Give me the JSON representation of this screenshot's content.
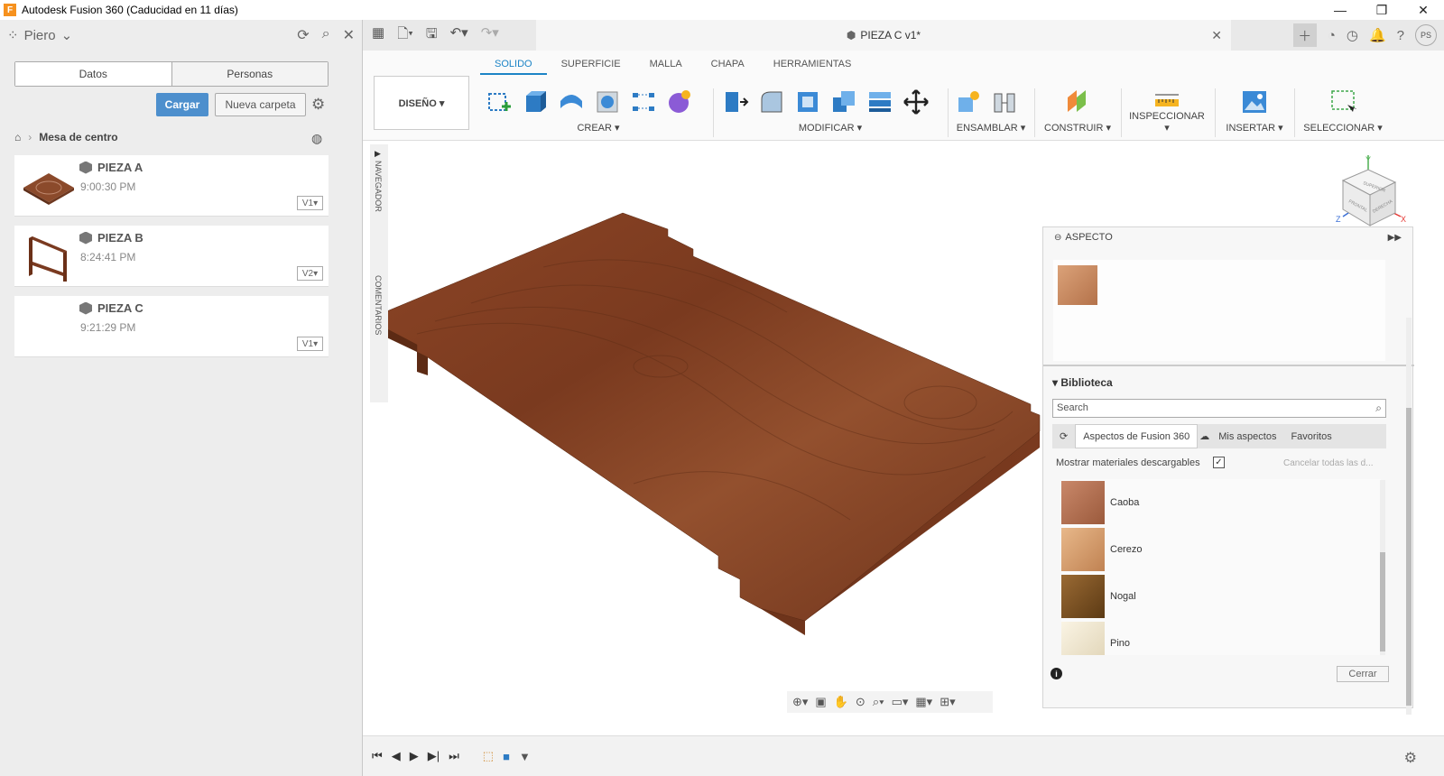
{
  "window": {
    "app_icon": "F",
    "title": "Autodesk Fusion 360 (Caducidad en 11 días)",
    "controls": [
      "—",
      "❐",
      "✕"
    ]
  },
  "data_panel": {
    "team": "Piero",
    "tabs": [
      "Datos",
      "Personas"
    ],
    "upload_label": "Cargar",
    "new_folder_label": "Nueva carpeta",
    "breadcrumb": "Mesa de centro",
    "files": [
      {
        "name": "PIEZA A",
        "time": "9:00:30 PM",
        "version": "V1▾"
      },
      {
        "name": "PIEZA B",
        "time": "8:24:41 PM",
        "version": "V2▾"
      },
      {
        "name": "PIEZA C",
        "time": "9:21:29 PM",
        "version": "V1▾"
      }
    ]
  },
  "document": {
    "tab_title": "PIEZA C v1*",
    "user_initials": "PS"
  },
  "ribbon": {
    "workspace": "DISEÑO ▾",
    "tabs": [
      "SOLIDO",
      "SUPERFICIE",
      "MALLA",
      "CHAPA",
      "HERRAMIENTAS"
    ],
    "active_tab": "SOLIDO",
    "groups": [
      "CREAR ▾",
      "MODIFICAR ▾",
      "ENSAMBLAR ▾",
      "CONSTRUIR ▾",
      "INSPECCIONAR ▾",
      "INSERTAR ▾",
      "SELECCIONAR ▾"
    ]
  },
  "side_strip": {
    "navigator": "NAVEGADOR",
    "comments": "COMENTARIOS"
  },
  "viewcube": {
    "faces": [
      "SUPERIOR",
      "FRONTAL",
      "DERECHA"
    ],
    "axes": [
      "Y",
      "Z",
      "X"
    ]
  },
  "appearance_panel": {
    "title": "ASPECTO",
    "library_label": "Biblioteca",
    "search_placeholder": "Search",
    "lib_tabs": [
      "Aspectos de Fusion 360",
      "Mis aspectos",
      "Favoritos"
    ],
    "show_downloadable": "Mostrar materiales descargables",
    "cancel_all": "Cancelar todas las d...",
    "materials": [
      {
        "name": "Caoba",
        "color": "#b06a4a"
      },
      {
        "name": "Cerezo",
        "color": "#d49a6a"
      },
      {
        "name": "Nogal",
        "color": "#7a5424"
      },
      {
        "name": "Pino",
        "color": "#efe6cf"
      }
    ],
    "close_label": "Cerrar"
  },
  "colors": {
    "accent": "#1c84c6",
    "primary_button": "#4d8fcd",
    "wood": "#8a3f22"
  }
}
